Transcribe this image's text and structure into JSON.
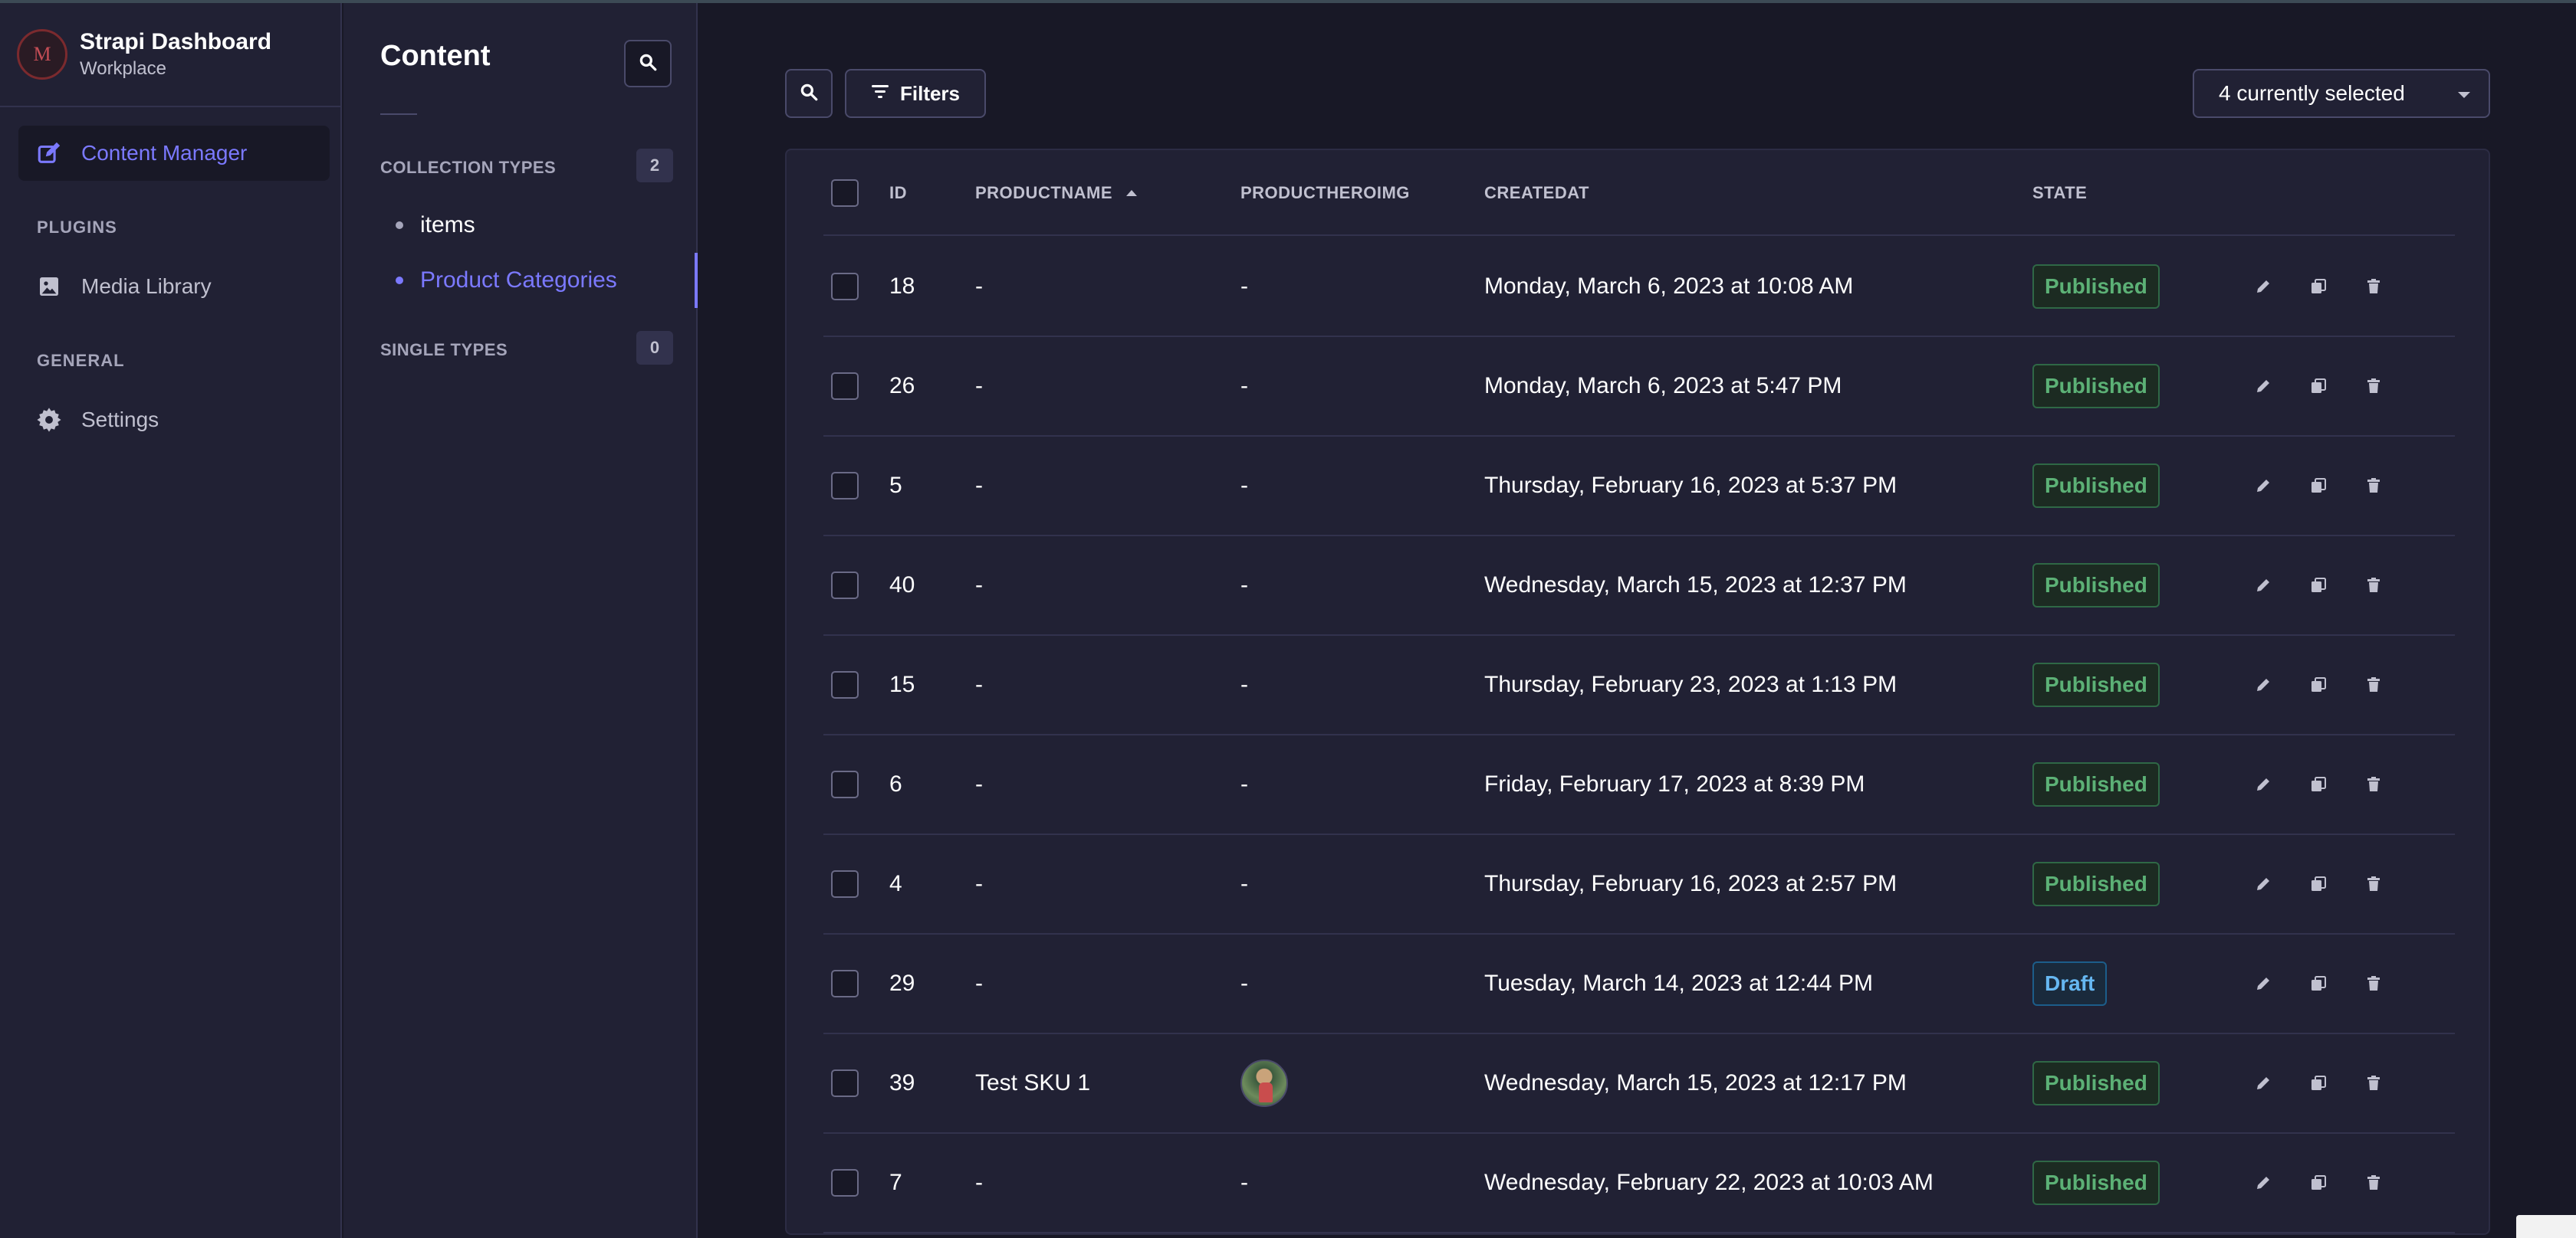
{
  "brand": {
    "logo_text": "M",
    "title": "Strapi Dashboard",
    "subtitle": "Workplace"
  },
  "nav": {
    "content_manager": "Content Manager",
    "plugins_label": "PLUGINS",
    "media_library": "Media Library",
    "general_label": "GENERAL",
    "settings": "Settings"
  },
  "subnav": {
    "title": "Content",
    "collection_types_label": "COLLECTION TYPES",
    "collection_types_count": "2",
    "collection_items": [
      {
        "label": "items"
      },
      {
        "label": "Product Categories"
      }
    ],
    "single_types_label": "SINGLE TYPES",
    "single_types_count": "0"
  },
  "toolbar": {
    "filters_label": "Filters",
    "columns_select": "4 currently selected"
  },
  "table": {
    "headers": {
      "id": "ID",
      "productname": "PRODUCTNAME",
      "productheroimg": "PRODUCTHEROIMG",
      "createdat": "CREATEDAT",
      "state": "STATE"
    },
    "rows": [
      {
        "id": "18",
        "name": "-",
        "img": "-",
        "created": "Monday, March 6, 2023 at 10:08 AM",
        "state": "Published"
      },
      {
        "id": "26",
        "name": "-",
        "img": "-",
        "created": "Monday, March 6, 2023 at 5:47 PM",
        "state": "Published"
      },
      {
        "id": "5",
        "name": "-",
        "img": "-",
        "created": "Thursday, February 16, 2023 at 5:37 PM",
        "state": "Published"
      },
      {
        "id": "40",
        "name": "-",
        "img": "-",
        "created": "Wednesday, March 15, 2023 at 12:37 PM",
        "state": "Published"
      },
      {
        "id": "15",
        "name": "-",
        "img": "-",
        "created": "Thursday, February 23, 2023 at 1:13 PM",
        "state": "Published"
      },
      {
        "id": "6",
        "name": "-",
        "img": "-",
        "created": "Friday, February 17, 2023 at 8:39 PM",
        "state": "Published"
      },
      {
        "id": "4",
        "name": "-",
        "img": "-",
        "created": "Thursday, February 16, 2023 at 2:57 PM",
        "state": "Published"
      },
      {
        "id": "29",
        "name": "-",
        "img": "-",
        "created": "Tuesday, March 14, 2023 at 12:44 PM",
        "state": "Draft"
      },
      {
        "id": "39",
        "name": "Test SKU 1",
        "img": "",
        "created": "Wednesday, March 15, 2023 at 12:17 PM",
        "state": "Published"
      },
      {
        "id": "7",
        "name": "-",
        "img": "-",
        "created": "Wednesday, February 22, 2023 at 10:03 AM",
        "state": "Published"
      }
    ]
  },
  "colors": {
    "accent": "#7b79ff",
    "published": "#5cb176",
    "draft": "#66b7f1"
  }
}
